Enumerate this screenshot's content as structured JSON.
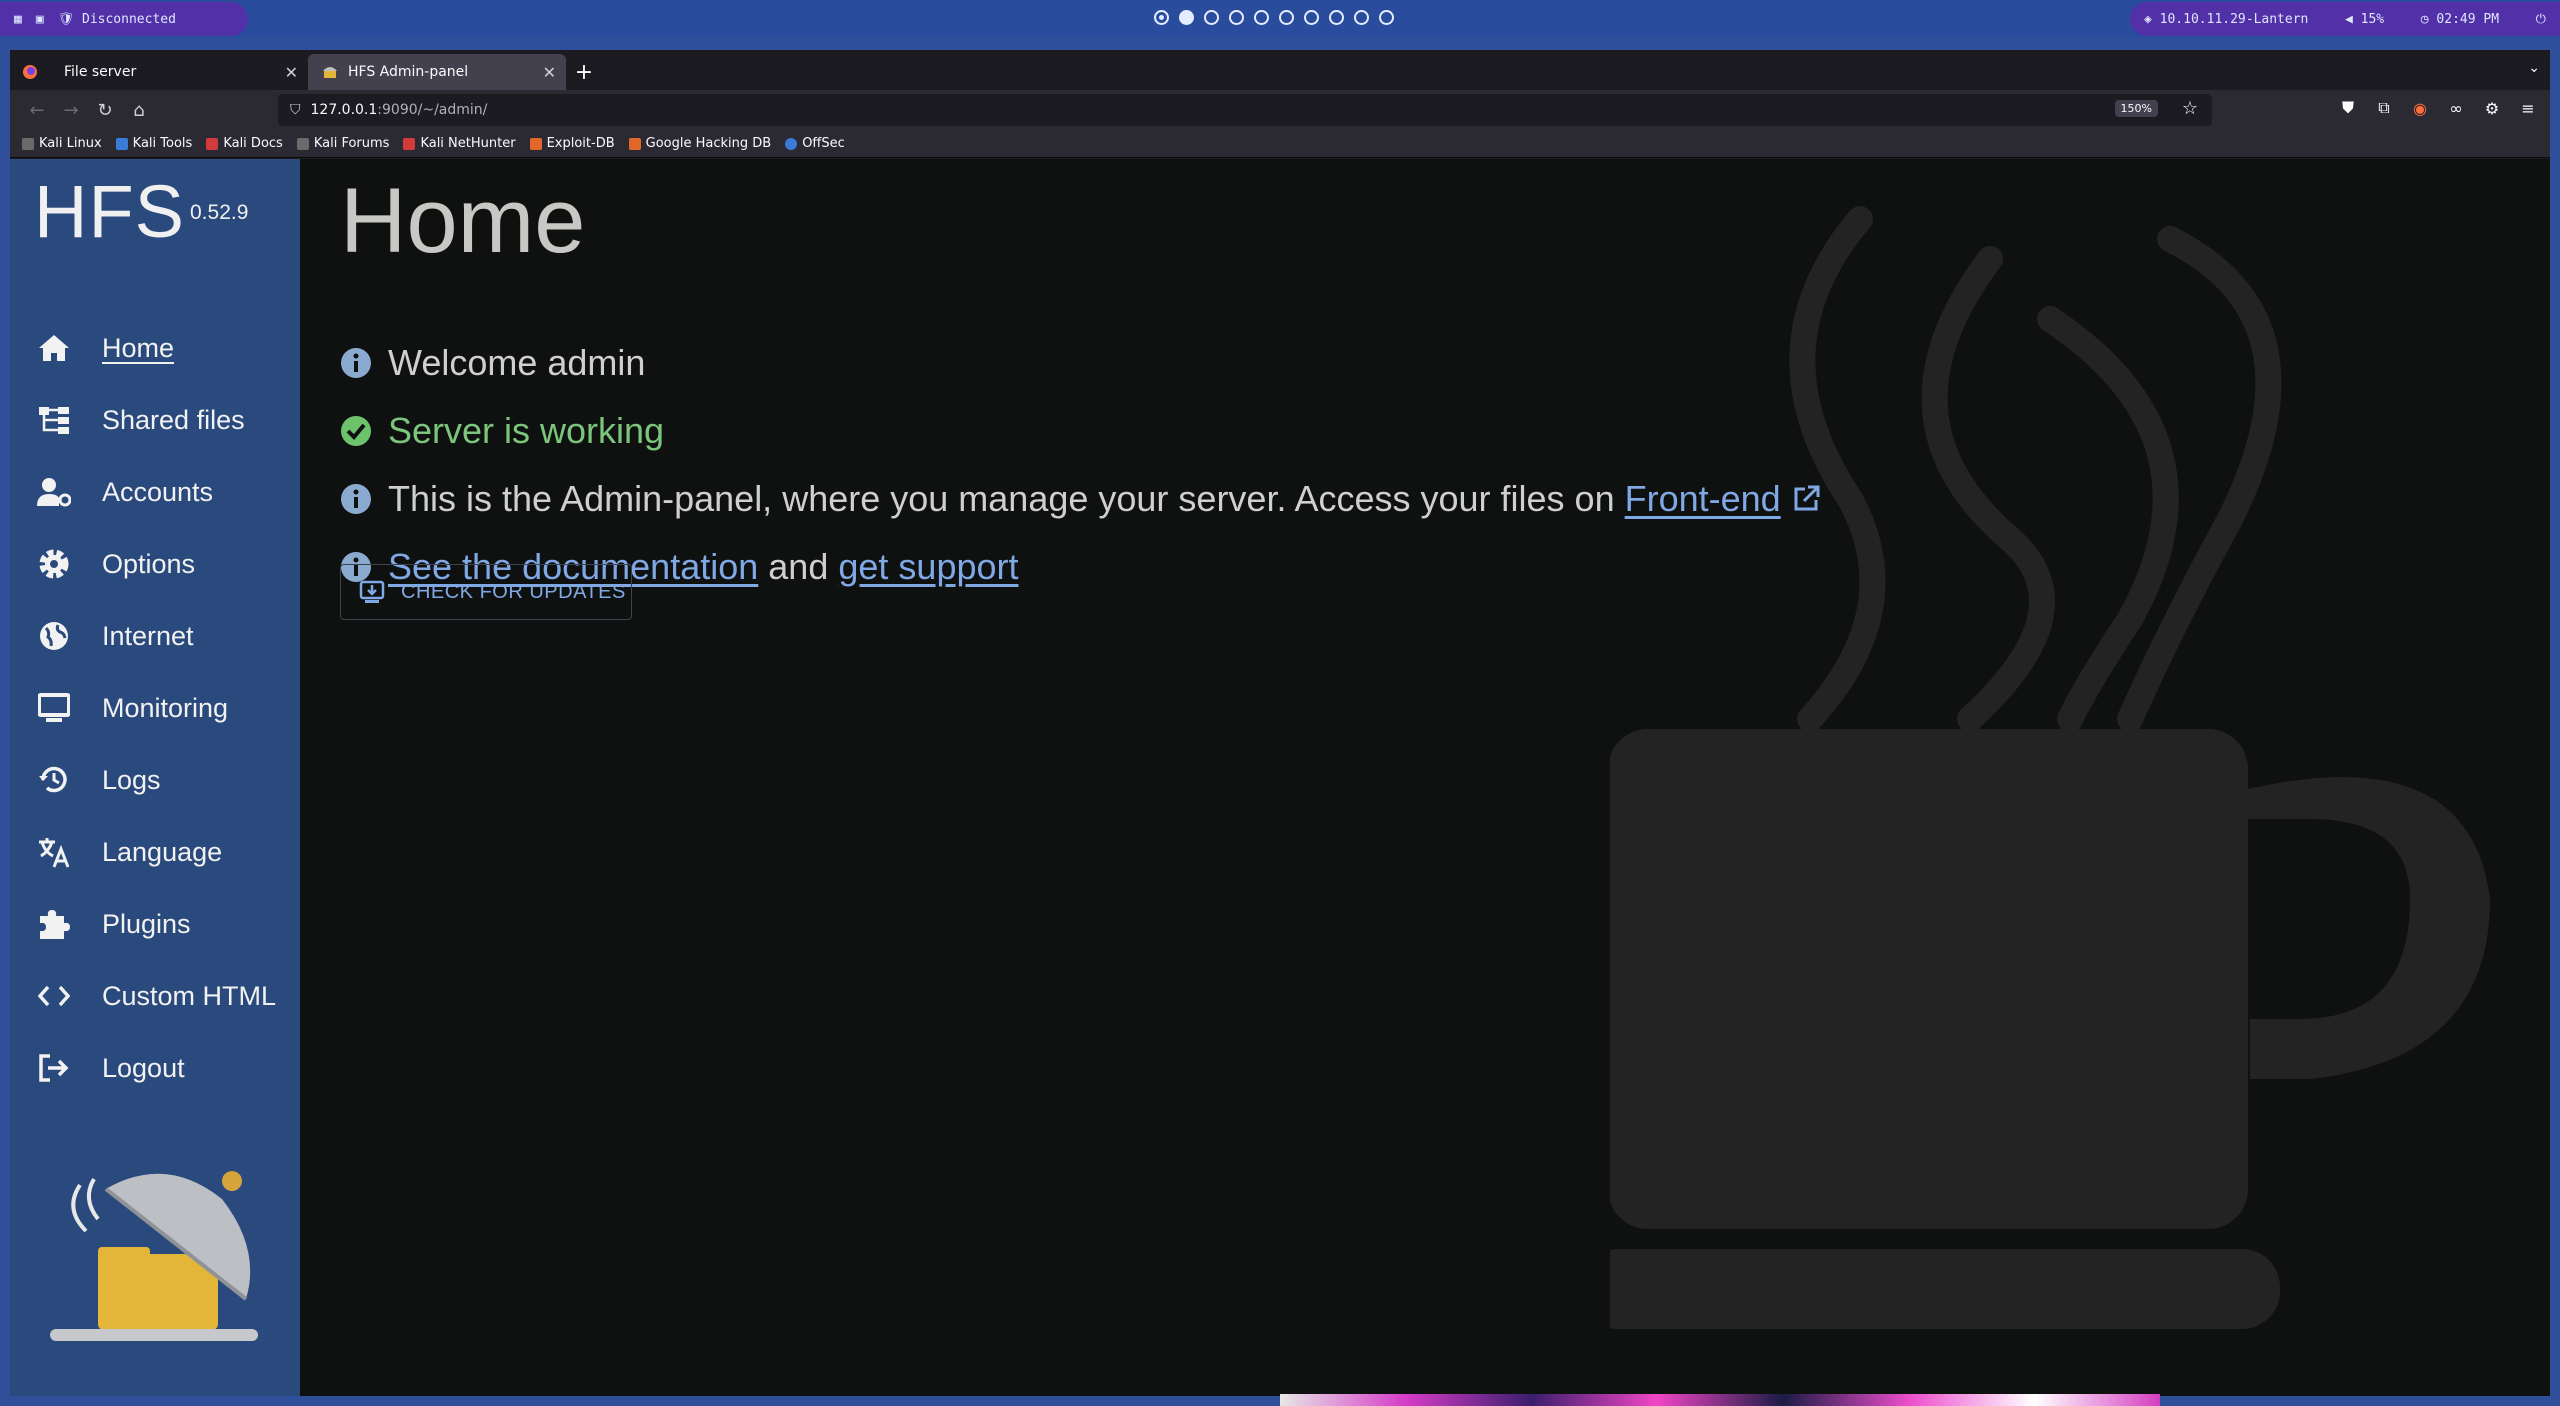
{
  "sysbar": {
    "vpn_status": "Disconnected",
    "network": "10.10.11.29-Lantern",
    "volume": "15%",
    "clock": "02:49 PM"
  },
  "browser": {
    "tabs": [
      {
        "label": "File server"
      },
      {
        "label": "HFS Admin-panel"
      }
    ],
    "url_host": "127.0.0.1",
    "url_rest": ":9090/~/admin/",
    "zoom": "150%",
    "bookmarks": [
      "Kali Linux",
      "Kali Tools",
      "Kali Docs",
      "Kali Forums",
      "Kali NetHunter",
      "Exploit-DB",
      "Google Hacking DB",
      "OffSec"
    ]
  },
  "sidebar": {
    "brand": "HFS",
    "version": "0.52.9",
    "items": [
      {
        "label": "Home",
        "icon": "home-icon"
      },
      {
        "label": "Shared files",
        "icon": "sitemap-icon"
      },
      {
        "label": "Accounts",
        "icon": "user-gear-icon"
      },
      {
        "label": "Options",
        "icon": "gear-icon"
      },
      {
        "label": "Internet",
        "icon": "globe-icon"
      },
      {
        "label": "Monitoring",
        "icon": "monitor-icon"
      },
      {
        "label": "Logs",
        "icon": "history-icon"
      },
      {
        "label": "Language",
        "icon": "translate-icon"
      },
      {
        "label": "Plugins",
        "icon": "puzzle-icon"
      },
      {
        "label": "Custom HTML",
        "icon": "code-icon"
      },
      {
        "label": "Logout",
        "icon": "logout-icon"
      }
    ]
  },
  "main": {
    "title": "Home",
    "welcome": "Welcome admin",
    "status": "Server is working",
    "admin_info": "This is the Admin-panel, where you manage your server. Access your files on",
    "frontend_link": "Front-end",
    "docs_link": "See the documentation",
    "and_text": "and",
    "support_link": "get support",
    "updates_button": "CHECK FOR UPDATES"
  }
}
